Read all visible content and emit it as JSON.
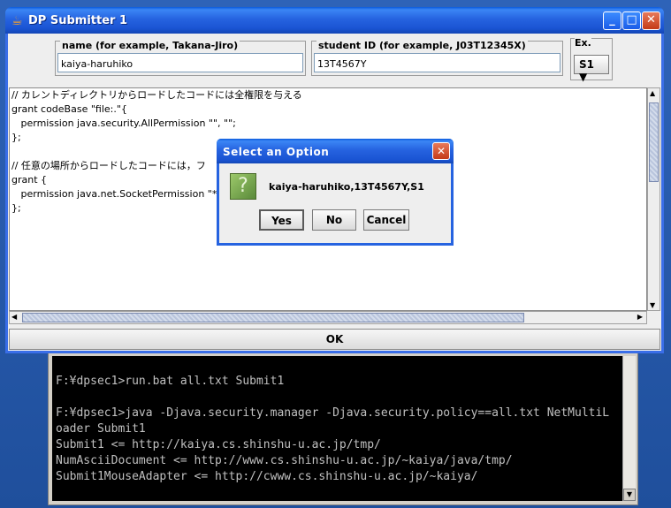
{
  "window": {
    "title": "DP Submitter 1"
  },
  "fields": {
    "name": {
      "legend": "name (for example, Takana-Jiro)",
      "value": "kaiya-haruhiko"
    },
    "student_id": {
      "legend": "student ID (for example, J03T12345X)",
      "value": "13T4567Y"
    },
    "ex": {
      "legend": "Ex.",
      "value": "S1"
    }
  },
  "editor": {
    "lines": [
      "// カレントディレクトリからロードしたコードには全権限を与える",
      "grant codeBase \"file:.\"{",
      "   permission java.security.AllPermission \"\", \"\";",
      "};",
      "",
      "// 任意の場所からロードしたコードには，フ",
      "grant {",
      "   permission java.net.SocketPermission \"*",
      "};"
    ]
  },
  "ok_label": "OK",
  "dialog": {
    "title": "Select an Option",
    "message": "kaiya-haruhiko,13T4567Y,S1",
    "yes": "Yes",
    "no": "No",
    "cancel": "Cancel"
  },
  "console": {
    "lines": [
      "F:¥dpsec1>run.bat all.txt Submit1",
      "",
      "F:¥dpsec1>java -Djava.security.manager -Djava.security.policy==all.txt NetMultiL",
      "oader Submit1",
      "Submit1 <= http://kaiya.cs.shinshu-u.ac.jp/tmp/",
      "NumAsciiDocument <= http://www.cs.shinshu-u.ac.jp/~kaiya/java/tmp/",
      "Submit1MouseAdapter <= http://cwww.cs.shinshu-u.ac.jp/~kaiya/"
    ]
  }
}
